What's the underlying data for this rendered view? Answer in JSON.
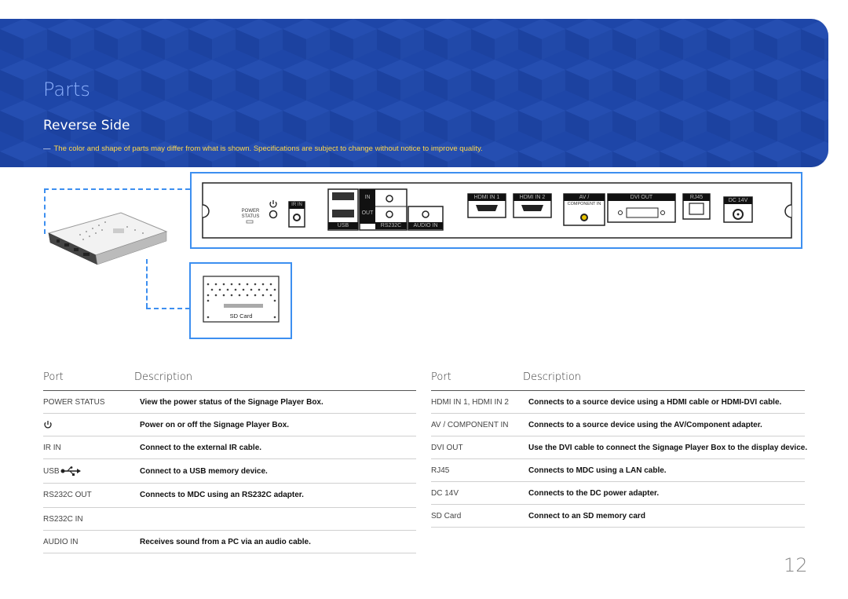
{
  "header": {
    "title": "Parts",
    "subtitle": "Reverse Side",
    "note": "The color and shape of parts may differ from what is shown. Specifications are subject to change without notice to improve quality."
  },
  "diagram": {
    "power_status_label": "POWER STATUS",
    "ir_label": "IR IN",
    "usb_in_label": "IN",
    "usb_out_label": "OUT",
    "usb_label": "USB",
    "rs232c_label": "RS232C",
    "audio_in_label": "AUDIO IN",
    "hdmi_in_1_label": "HDMI IN 1",
    "hdmi_in_2_label": "HDMI IN 2",
    "av_label": "AV /",
    "component_label": "COMPONENT IN",
    "dvi_out_label": "DVI OUT",
    "rj45_label": "RJ45",
    "dc_label": "DC 14V",
    "sd_card_label": "SD Card"
  },
  "left_table": {
    "col_port": "Port",
    "col_desc": "Description",
    "rows": [
      {
        "port": "POWER STATUS",
        "desc": "View the power status of the Signage Player Box."
      },
      {
        "port": "",
        "desc": "Power on or off the Signage Player Box."
      },
      {
        "port": "IR IN",
        "desc": "Connect to the external IR cable."
      },
      {
        "port": "USB",
        "desc": "Connect to a USB memory device."
      },
      {
        "port": "RS232C OUT",
        "desc": "Connects to MDC using an RS232C adapter."
      },
      {
        "port": "RS232C IN",
        "desc": ""
      },
      {
        "port": "AUDIO IN",
        "desc": "Receives sound from a PC via an audio cable."
      }
    ]
  },
  "right_table": {
    "col_port": "Port",
    "col_desc": "Description",
    "rows": [
      {
        "port": "HDMI IN 1, HDMI IN 2",
        "desc": "Connects to a source device using a HDMI cable or HDMI-DVI cable."
      },
      {
        "port": "AV / COMPONENT IN",
        "desc": "Connects to a source device using the AV/Component adapter."
      },
      {
        "port": "DVI OUT",
        "desc": "Use the DVI cable to connect the Signage Player Box to the display device."
      },
      {
        "port": "RJ45",
        "desc": "Connects to MDC using a LAN cable."
      },
      {
        "port": "DC 14V",
        "desc": "Connects to the DC power adapter."
      },
      {
        "port": "SD Card",
        "desc": "Connect to an SD memory card"
      }
    ]
  },
  "page_number": "12",
  "colors": {
    "banner": "#1e46a8",
    "title": "#8fb3ff",
    "note": "#ffd84a",
    "callout": "#3d8ff0"
  }
}
